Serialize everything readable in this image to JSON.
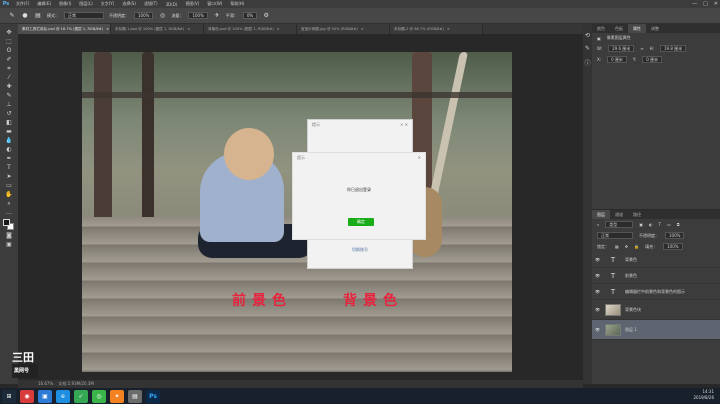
{
  "menubar": {
    "app_icon": "Ps",
    "items": [
      "文件(F)",
      "编辑(E)",
      "图像(I)",
      "图层(L)",
      "文字(Y)",
      "选择(S)",
      "滤镜(T)",
      "3D(D)",
      "视图(V)",
      "窗口(W)",
      "帮助(H)"
    ],
    "minimize": "—",
    "maximize": "□",
    "close": "✕"
  },
  "options": {
    "mode_label": "模式：",
    "mode_value": "正常",
    "opacity_label": "不透明度：",
    "opacity_value": "100%",
    "flow_label": "流量：",
    "flow_value": "100%",
    "smooth_label": "平滑：",
    "smooth_value": "0%"
  },
  "tabs": [
    {
      "label": "素材工具栏前后.psd @ 16.7% (图层 1, RGB/8#)",
      "active": true
    },
    {
      "label": "未标题-1.psd @ 100% (图层 1, RGB/8#)",
      "active": false
    },
    {
      "label": "背景色.psd @ 100% (图层 1, RGB/8#)",
      "active": false
    },
    {
      "label": "宝宝示例图.jpg @ 50% (RGB/8#)",
      "active": false
    },
    {
      "label": "未标题-2 @ 66.7% (RGB/8#)",
      "active": false
    }
  ],
  "canvas": {
    "fg_label": "前景色",
    "bg_label": "背景色",
    "dialog_back_title": "提示",
    "dialog_front_title": "提示",
    "dialog_message": "你已退出登录",
    "dialog_button": "确定",
    "dialog_link": "切换账号"
  },
  "status": {
    "zoom": "16.67%",
    "doc_info": "文档:5.93M/20.3M"
  },
  "right_panel": {
    "top_tabs": [
      "颜色",
      "色板",
      "属性",
      "调整"
    ],
    "active_top_tab": "属性",
    "properties_title": "像素图层属性",
    "w_label": "W:",
    "w_value": "29.6 厘米",
    "h_label": "H:",
    "h_value": "19.8 厘米",
    "x_label": "X:",
    "x_value": "0 厘米",
    "y_label": "Y:",
    "y_value": "0 厘米",
    "layer_tabs": [
      "图层",
      "通道",
      "路径"
    ],
    "filter_value": "类型",
    "blend_value": "正常",
    "opacity_label": "不透明度：",
    "opacity_value": "100%",
    "lock_label": "锁定：",
    "fill_label": "填充：",
    "fill_value": "100%",
    "layers": [
      {
        "name": "背景色",
        "type": "text",
        "selected": false
      },
      {
        "name": "前景色",
        "type": "text",
        "selected": false
      },
      {
        "name": "编辑器栏中前景色和背景色的图示",
        "type": "text",
        "selected": false
      },
      {
        "name": "背景色块",
        "type": "image",
        "selected": false
      },
      {
        "name": "图层 1",
        "type": "image",
        "selected": true
      }
    ]
  },
  "watermark": {
    "big": "三田",
    "small": "黑网号"
  },
  "clock": {
    "time": "14:31",
    "date": "2019/8/26"
  },
  "colors": {
    "accent_red": "#e8233d",
    "button_green": "#1aad19"
  }
}
